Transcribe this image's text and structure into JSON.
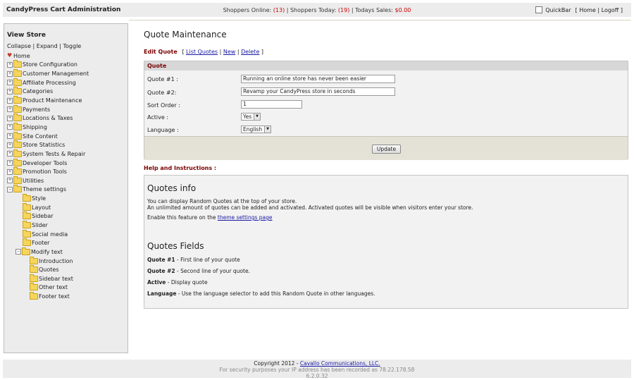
{
  "topbar": {
    "app_title": "CandyPress Cart Administration",
    "shoppers_online_label": "Shoppers Online:",
    "shoppers_online_value": "(13)",
    "shoppers_today_label": "| Shoppers Today:",
    "shoppers_today_value": "(19)",
    "todays_sales_label": "| Todays Sales:",
    "todays_sales_value": "$0.00",
    "quickbar_label": "QuickBar",
    "home_link": "Home",
    "logoff_link": "Logoff"
  },
  "sidebar": {
    "title": "View Store",
    "collapse": "Collapse",
    "expand": "Expand",
    "toggle": "Toggle",
    "home": "Home",
    "items": [
      {
        "label": "Store Configuration"
      },
      {
        "label": "Customer Management"
      },
      {
        "label": "Affiliate Processing"
      },
      {
        "label": "Categories"
      },
      {
        "label": "Product Maintenance"
      },
      {
        "label": "Payments"
      },
      {
        "label": "Locations & Taxes"
      },
      {
        "label": "Shipping"
      },
      {
        "label": "Site Content"
      },
      {
        "label": "Store Statistics"
      },
      {
        "label": "System Tests & Repair"
      },
      {
        "label": "Developer Tools"
      },
      {
        "label": "Promotion Tools"
      },
      {
        "label": "Utilities"
      },
      {
        "label": "Theme settings"
      }
    ],
    "theme_children": [
      {
        "label": "Style"
      },
      {
        "label": "Layout"
      },
      {
        "label": "Sidebar"
      },
      {
        "label": "Slider"
      },
      {
        "label": "Social media"
      },
      {
        "label": "Footer"
      },
      {
        "label": "Modify text"
      }
    ],
    "modify_text_children": [
      {
        "label": "Introduction"
      },
      {
        "label": "Quotes"
      },
      {
        "label": "Sidebar text"
      },
      {
        "label": "Other text"
      },
      {
        "label": "Footer text"
      }
    ]
  },
  "main": {
    "page_title": "Quote Maintenance",
    "edit_label": "Edit Quote",
    "list_link": "List Quotes",
    "new_link": "New",
    "delete_link": "Delete",
    "panel_title": "Quote",
    "fields": {
      "quote1_label": "Quote #1 :",
      "quote1_value": "Running an online store has never been easier",
      "quote2_label": "Quote #2:",
      "quote2_value": "Revamp your CandyPress store in seconds",
      "sort_label": "Sort Order :",
      "sort_value": "1",
      "active_label": "Active :",
      "active_value": "Yes",
      "language_label": "Language :",
      "language_value": "English"
    },
    "update_button": "Update",
    "help_title": "Help and Instructions :",
    "help": {
      "info_heading": "Quotes info",
      "info_line1": "You can display Random Quotes at the top of your store.",
      "info_line2": "An unlimited amount of quotes can be added and activated. Activated quotes will be visible when visitors enter your store.",
      "enable_prefix": "Enable this feature on the",
      "enable_link": "theme settings page",
      "fields_heading": "Quotes Fields",
      "q1_term": "Quote #1",
      "q1_desc": " - First line of your quote",
      "q2_term": "Quote #2",
      "q2_desc": " - Second line of your quote.",
      "active_term": "Active",
      "active_desc": " - Display quote",
      "lang_term": "Language",
      "lang_desc": " - Use the language selector to add this Random Quote in other languages."
    }
  },
  "footer": {
    "copyright": "Copyright 2012 -",
    "company_link": "Cavallo Communications, LLC.",
    "security_note": "For security purposes your IP address has been recorded as 78.22.178.58",
    "version": "6.2.0.32"
  }
}
